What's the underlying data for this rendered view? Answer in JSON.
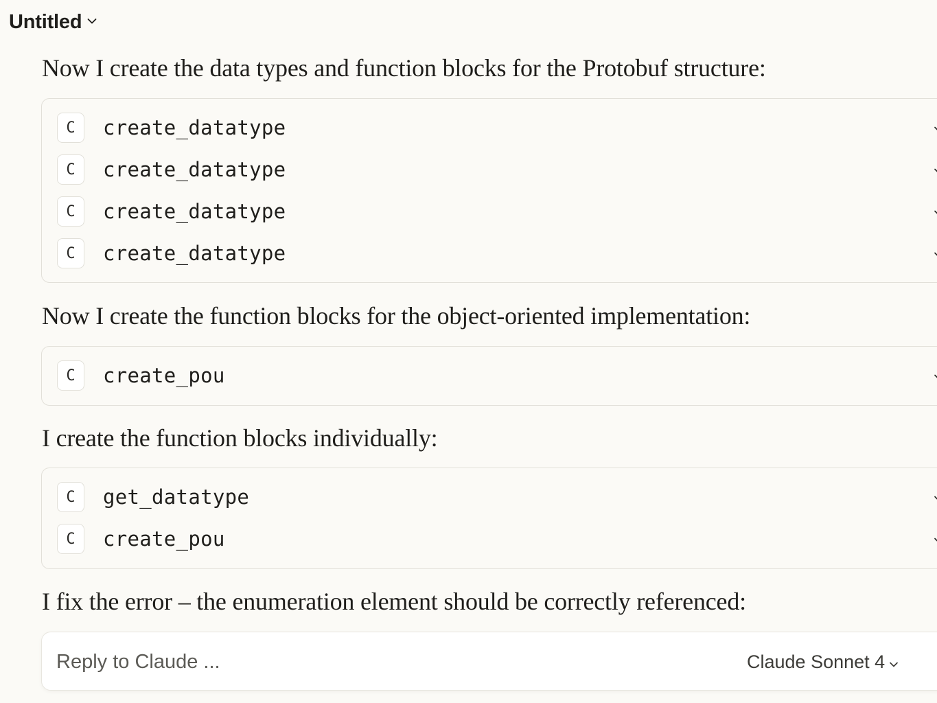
{
  "header": {
    "title": "Untitled"
  },
  "messages": [
    {
      "text": "Now I create the data types and function blocks for the Protobuf structure:"
    },
    {
      "text": "Now I create the function blocks for the object-oriented implementation:"
    },
    {
      "text": "I create the function blocks individually:"
    },
    {
      "text": "I fix the error – the enumeration element should be correctly referenced:"
    }
  ],
  "tool_groups": [
    {
      "calls": [
        {
          "badge": "C",
          "name": "create_datatype"
        },
        {
          "badge": "C",
          "name": "create_datatype"
        },
        {
          "badge": "C",
          "name": "create_datatype"
        },
        {
          "badge": "C",
          "name": "create_datatype"
        }
      ]
    },
    {
      "calls": [
        {
          "badge": "C",
          "name": "create_pou"
        }
      ]
    },
    {
      "calls": [
        {
          "badge": "C",
          "name": "get_datatype"
        },
        {
          "badge": "C",
          "name": "create_pou"
        }
      ]
    }
  ],
  "composer": {
    "placeholder": "Reply to Claude ...",
    "model_label": "Claude Sonnet 4",
    "model_icon": "chevron-down-icon"
  }
}
